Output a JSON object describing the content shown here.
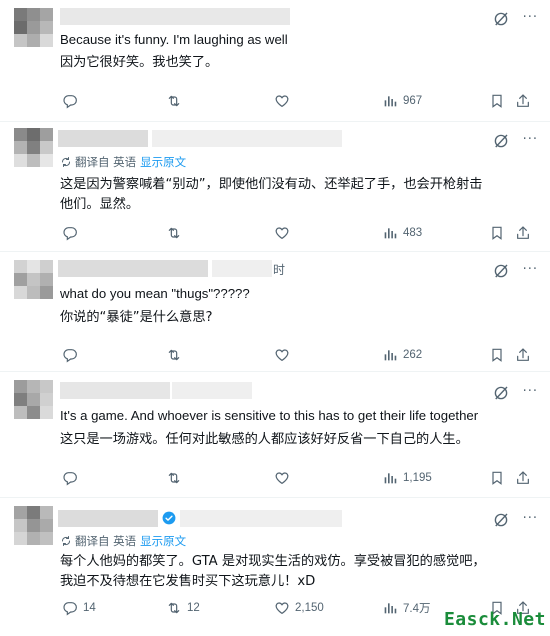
{
  "translate_label": "翻译自 英语",
  "show_original_label": "显示原文",
  "posts": [
    {
      "text_en": "Because it's funny. I'm laughing as well",
      "text_zh": "因为它很好笑。我也笑了。",
      "replies": "",
      "reposts": "",
      "likes": "",
      "views": "967"
    },
    {
      "text_zh": "这是因为警察喊着“别动”，即使他们没有动、还举起了手，也会开枪射击他们。显然。",
      "replies": "",
      "reposts": "",
      "likes": "",
      "views": "483"
    },
    {
      "name_tail": "时",
      "text_en": "what do you mean \"thugs\"?????",
      "text_zh": "你说的“暴徒”是什么意思?",
      "replies": "",
      "reposts": "",
      "likes": "",
      "views": "262"
    },
    {
      "text_en": "It's a game. And whoever is sensitive to this has to get their life together",
      "text_zh": "这只是一场游戏。任何对此敏感的人都应该好好反省一下自己的人生。",
      "replies": "",
      "reposts": "",
      "likes": "",
      "views": "1,195"
    },
    {
      "text_zh": "每个人他妈的都笑了。GTA 是对现实生活的戏仿。享受被冒犯的感觉吧，我迫不及待想在它发售时买下这玩意儿！xD",
      "replies": "14",
      "reposts": "12",
      "likes": "2,150",
      "views": "7.4万"
    }
  ],
  "watermark": "Easck.Net",
  "colors": {
    "link": "#1d9bf0",
    "muted": "#536471",
    "text": "#0f1419",
    "verified": "#1d9bf0"
  },
  "icons": [
    "grok-icon",
    "more-icon",
    "reply-icon",
    "repost-icon",
    "like-icon",
    "views-icon",
    "bookmark-icon",
    "share-icon",
    "translate-icon",
    "verified-badge-icon"
  ]
}
